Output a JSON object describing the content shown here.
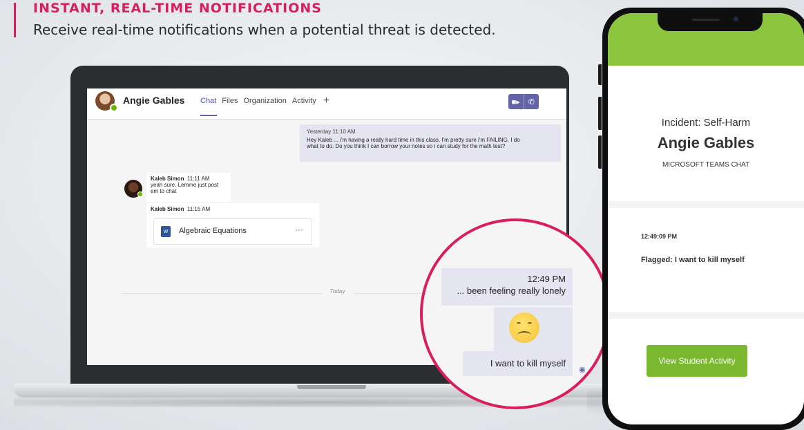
{
  "header": {
    "title": "INSTANT, REAL-TIME NOTIFICATIONS",
    "subtitle": "Receive real-time notifications when a potential threat is detected."
  },
  "teams": {
    "contact_name": "Angie Gables",
    "tabs": [
      "Chat",
      "Files",
      "Organization",
      "Activity"
    ],
    "add_tab_icon": "plus-icon",
    "video_call_icon": "video-camera-icon",
    "audio_call_icon": "phone-icon",
    "messages": [
      {
        "time": "Yesterday 11:10 AM",
        "text": "Hey Kaleb ... i'm having a really hard time in this class. I'm pretty sure i'm FAILING. I do",
        "text2": "what to do. Do you think I can borrow your notes so i can study for the math test?"
      },
      {
        "sender": "Kaleb Simon",
        "time": "11:11 AM",
        "text": "yeah sure. Lemme just post em to chat"
      },
      {
        "sender": "Kaleb Simon",
        "time": "11:15 AM",
        "file_name": "Algebraic Equations",
        "file_more": "···"
      }
    ],
    "divider_label": "Today"
  },
  "magnifier": {
    "time": "12:49 PM",
    "message1": "... been feeling really lonely",
    "emoji": "sad-face-emoji",
    "message3": "I want to kill myself",
    "seen_icon": "eye-icon"
  },
  "phone": {
    "incident": "Incident: Self-Harm",
    "student": "Angie Gables",
    "source": "MICROSOFT TEAMS CHAT",
    "timestamp": "12:49:09 PM",
    "flagged": "Flagged: I want to kill myself",
    "button": "View Student Activity"
  },
  "colors": {
    "accent": "#d81e5b",
    "teams_purple": "#6264a7",
    "phone_green": "#8cc63f",
    "button_green": "#79b82f"
  }
}
